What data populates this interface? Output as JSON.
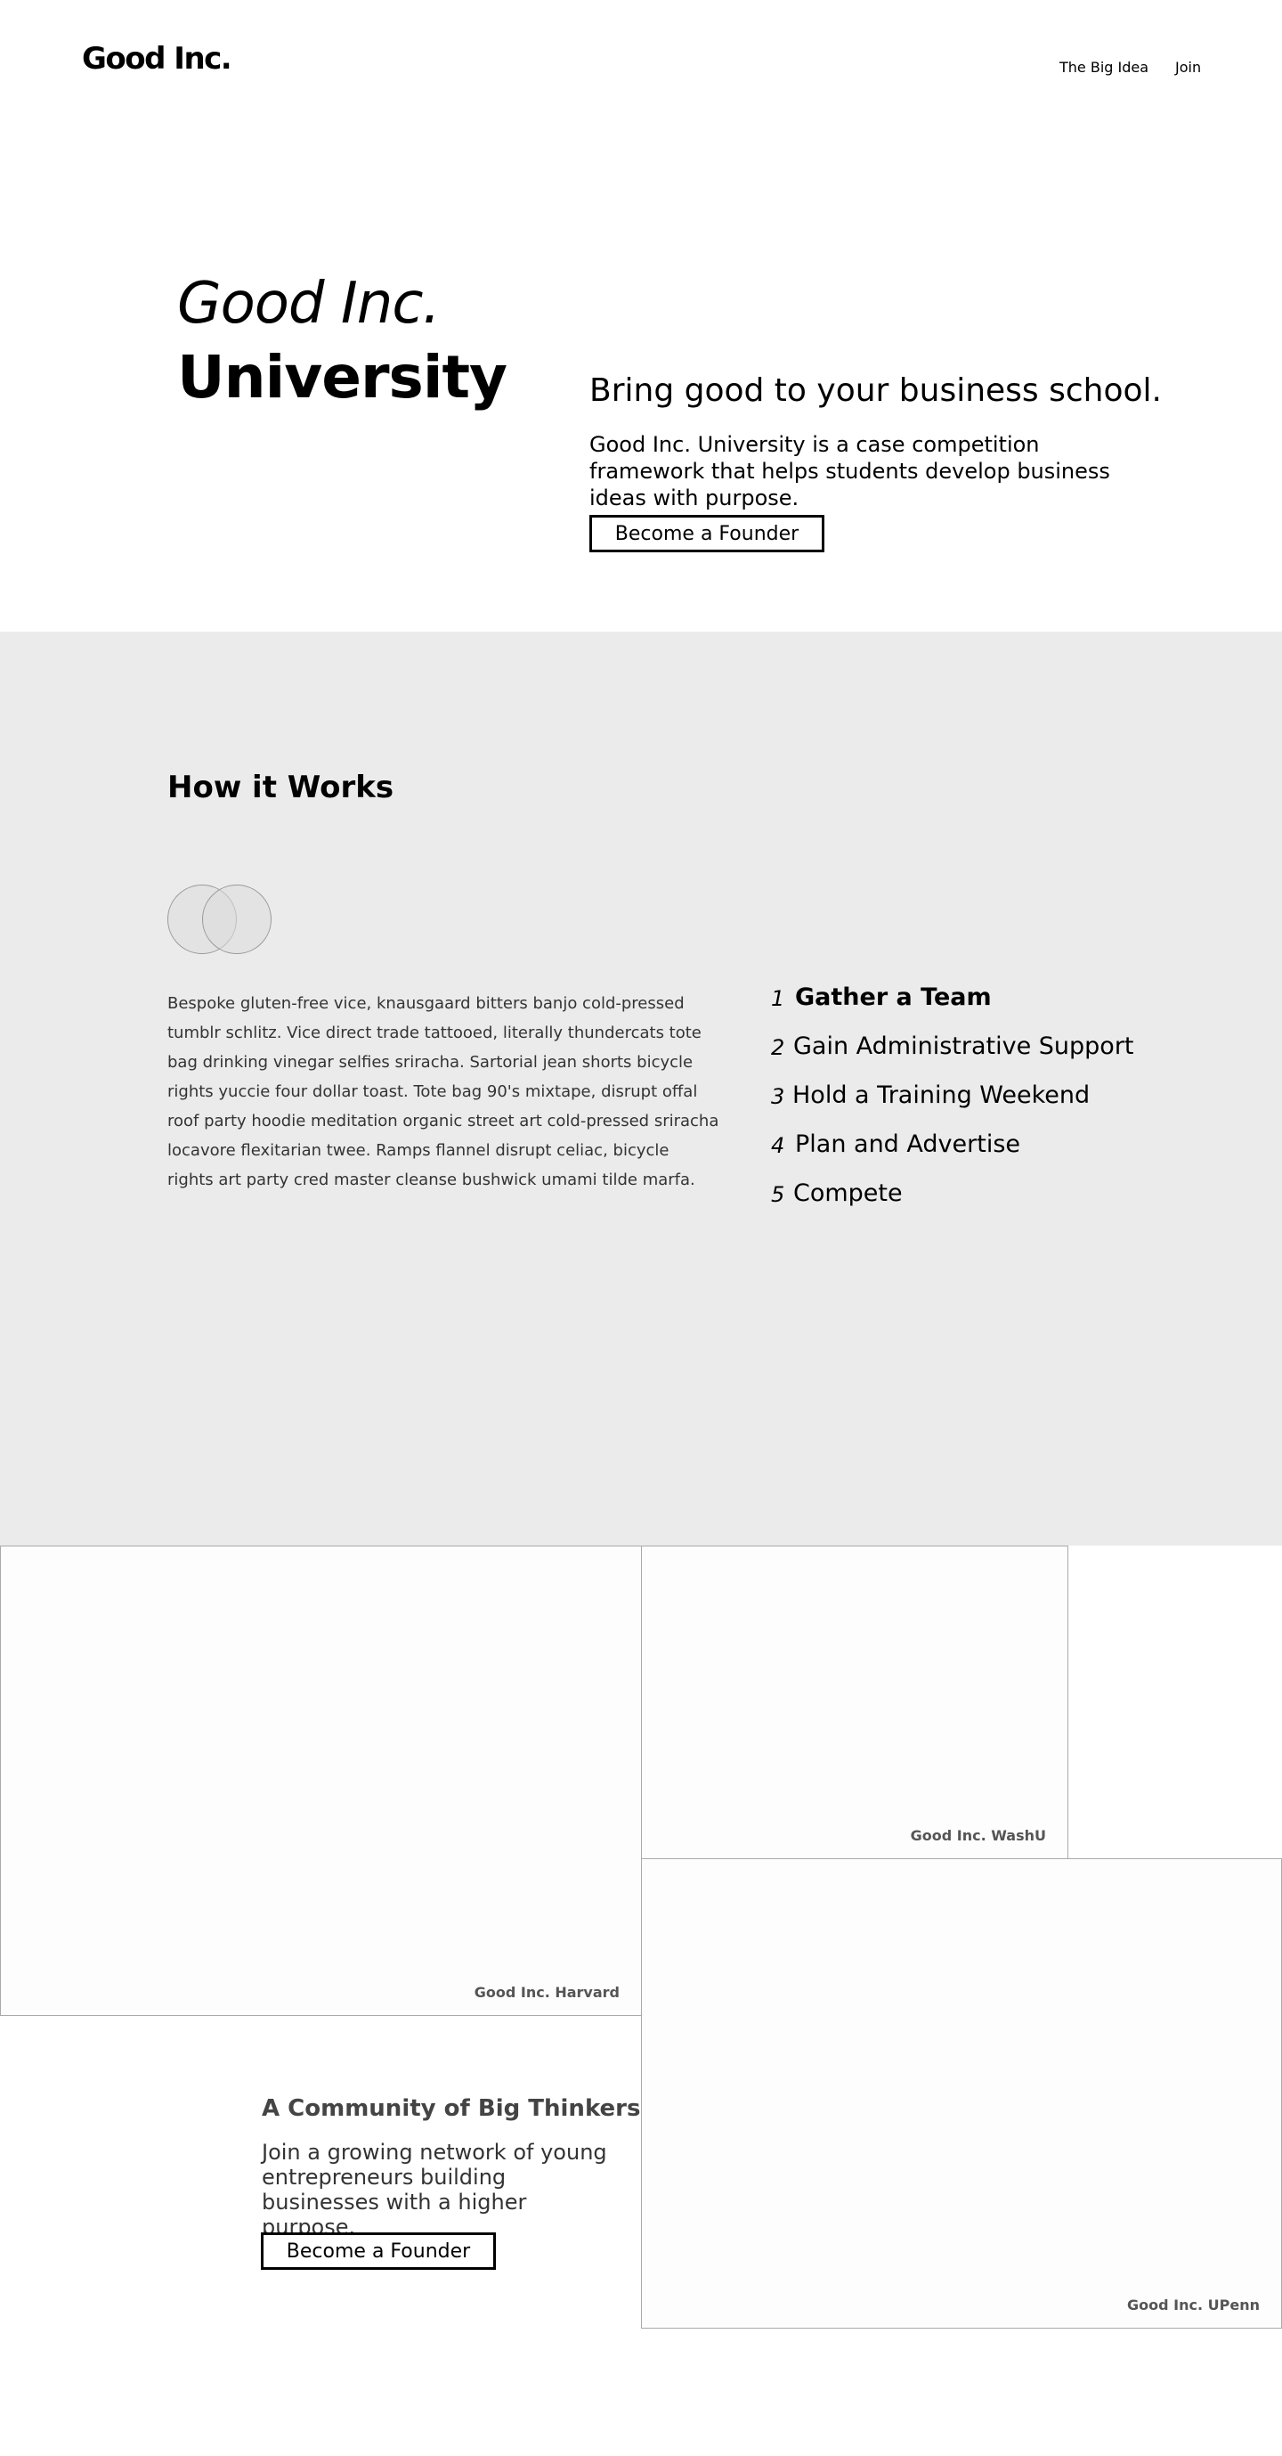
{
  "header": {
    "logo": "Good Inc.",
    "nav": [
      {
        "label": "The Big Idea"
      },
      {
        "label": "Join"
      }
    ]
  },
  "hero": {
    "title_italic": "Good Inc.",
    "title_bold": "University",
    "subtitle": "Bring good to your business school.",
    "description": "Good Inc. University is a case competition framework that helps students develop business ideas with purpose.",
    "cta_label": "Become a Founder"
  },
  "how_it_works": {
    "title": "How it Works",
    "body": "Bespoke gluten-free vice, knausgaard bitters banjo cold-pressed tumblr schlitz. Vice direct trade tattooed, literally thundercats tote bag drinking vinegar selfies sriracha. Sartorial jean shorts bicycle rights yuccie four dollar toast. Tote bag 90's mixtape, disrupt offal roof party hoodie meditation organic street art cold-pressed sriracha locavore flexitarian twee. Ramps flannel disrupt celiac, bicycle rights art party cred master cleanse bushwick umami tilde marfa.",
    "steps": [
      {
        "number": "1",
        "label": "Gather a Team"
      },
      {
        "number": "2",
        "label": "Gain Administrative Support"
      },
      {
        "number": "3",
        "label": "Hold a Training Weekend"
      },
      {
        "number": "4",
        "label": "Plan and Advertise"
      },
      {
        "number": "5",
        "label": "Compete"
      }
    ]
  },
  "gallery": {
    "cards": [
      {
        "label": "Good Inc. Harvard"
      },
      {
        "label": "Good Inc. WashU"
      },
      {
        "label": "Good Inc. UPenn"
      }
    ]
  },
  "community": {
    "title": "A Community of Big Thinkers",
    "description": "Join a growing network of young entrepreneurs building businesses with a higher purpose.",
    "cta_label": "Become a Founder"
  }
}
